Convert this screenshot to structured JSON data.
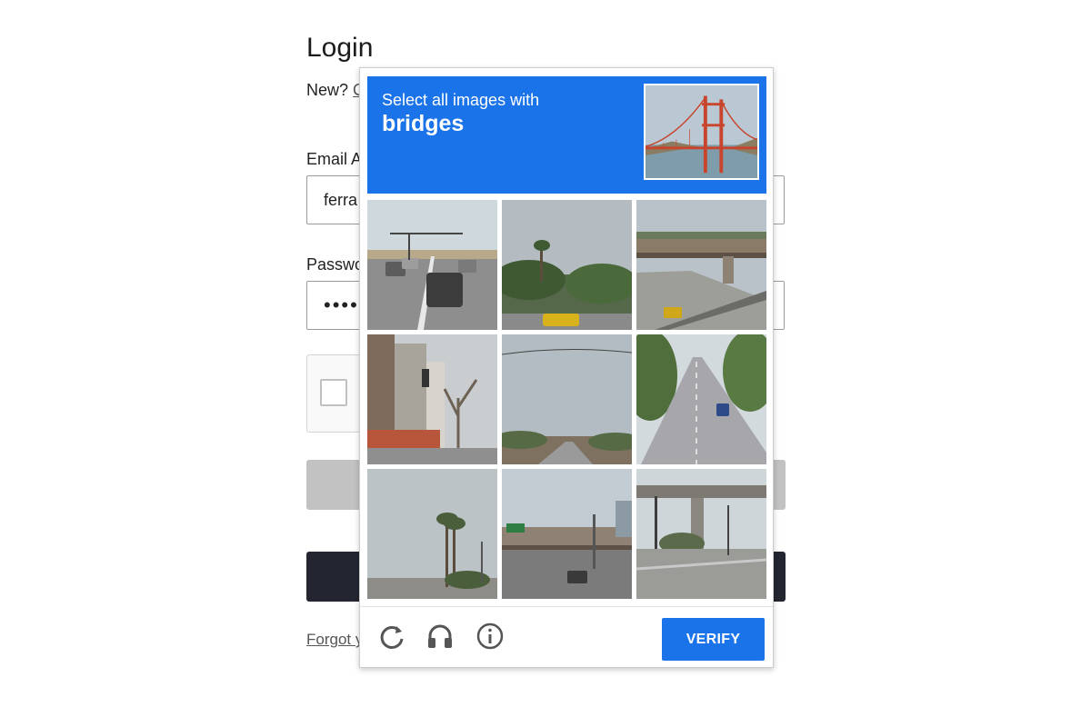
{
  "login": {
    "title": "Login",
    "new_prefix": "New?",
    "new_link": "C",
    "email_label": "Email A",
    "email_value": "ferra",
    "password_label": "Passwo",
    "password_value": "••••",
    "forgot_link": "Forgot y"
  },
  "captcha": {
    "instruction": "Select all images with",
    "target": "bridges",
    "verify_label": "VERIFY",
    "icons": [
      "reload-icon",
      "headphones-icon",
      "info-icon"
    ],
    "accent_color": "#1a73e8"
  }
}
